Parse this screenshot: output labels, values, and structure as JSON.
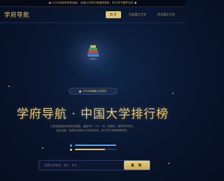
{
  "announcement": "● 2026年高考择校指南 · 全国大学排行榜重磅更新，助力学子圆梦名校 ●",
  "nav": {
    "logo": "学府导航",
    "items": [
      {
        "label": "首 页",
        "active": true
      },
      {
        "label": "大连理工大学",
        "active": false
      },
      {
        "label": "武汉理工大学",
        "active": false
      }
    ]
  },
  "hero": {
    "badge": "2026年最新大学排行",
    "title": "学府导航 · 中国大学排行榜",
    "subtitle_line1": "汇集全国高校权威排名数据，涵盖985、211、双一流高校，提供学科评估、",
    "subtitle_line2": "招生信息、校园文化等全方位参考资讯，助力学子选择理想学府。"
  },
  "legend": [
    {
      "color": "#5aa0e6",
      "fill": 0.98
    },
    {
      "color": "#e0c070",
      "fill": 0.72
    }
  ],
  "search": {
    "placeholder": "搜索大学名称、所在、专业…",
    "button": "查 询"
  },
  "colors": {
    "accent_gold": "#e2c56f",
    "background": "#0a1730",
    "blue": "#5aa0e6"
  }
}
